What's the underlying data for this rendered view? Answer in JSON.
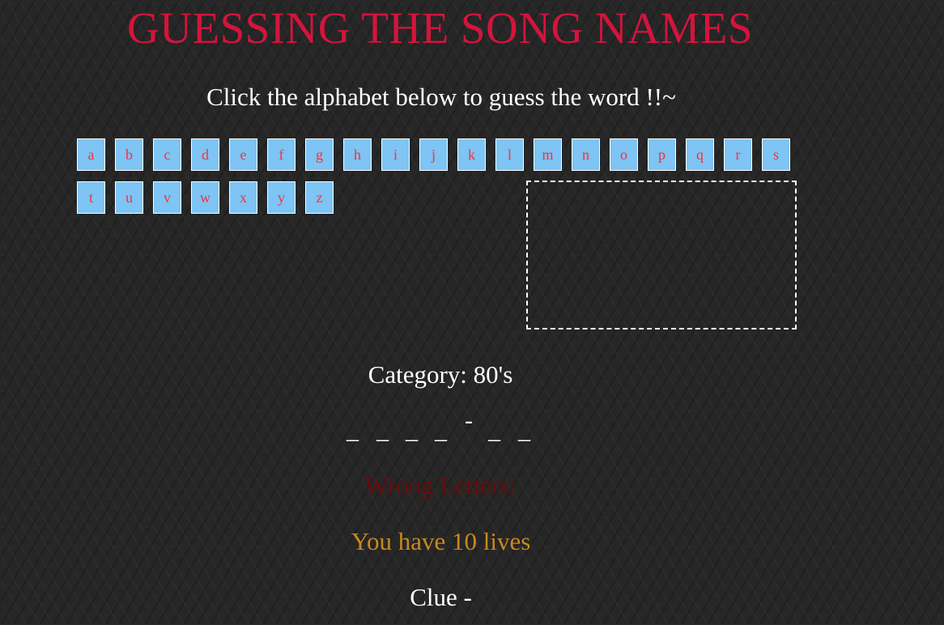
{
  "title": "GUESSING THE SONG NAMES",
  "instructions": "Click the alphabet below to guess the word !!~",
  "alphabet": [
    "a",
    "b",
    "c",
    "d",
    "e",
    "f",
    "g",
    "h",
    "i",
    "j",
    "k",
    "l",
    "m",
    "n",
    "o",
    "p",
    "q",
    "r",
    "s",
    "t",
    "u",
    "v",
    "w",
    "x",
    "y",
    "z"
  ],
  "category": "Category: 80's",
  "word_slots": [
    "_",
    "_",
    "_",
    "_",
    "-",
    "_",
    "_"
  ],
  "wrong_letters": "Wrong Letters:",
  "lives": "You have 10 lives",
  "clue": "Clue -",
  "colors": {
    "title": "#d4143c",
    "letter_bg": "#7ec4f4",
    "letter_text": "#f2323a",
    "wrong_letters": "#6b0a0a",
    "lives": "#c9891e",
    "background": "#262626"
  }
}
